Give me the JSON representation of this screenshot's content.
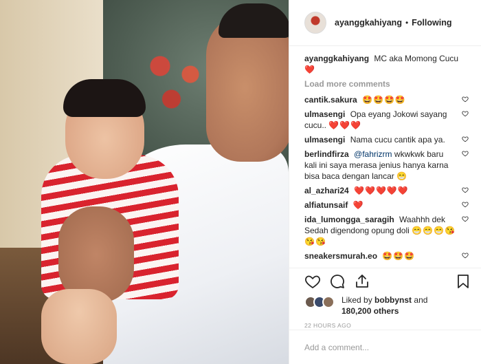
{
  "post": {
    "username": "ayanggkahiyang",
    "follow_status": "Following",
    "separator": "•",
    "caption_user": "ayanggkahiyang",
    "caption_text": "MC aka Momong Cucu",
    "caption_emoji": "❤️",
    "load_more": "Load more comments"
  },
  "comments": [
    {
      "user": "cantik.sakura",
      "text": "",
      "emoji": "🤩🤩🤩🤩"
    },
    {
      "user": "ulmasengi",
      "text": "Opa eyang Jokowi sayang cucu..",
      "emoji": "❤️❤️❤️"
    },
    {
      "user": "ulmasengi",
      "text": "Nama cucu cantik apa ya.",
      "emoji": ""
    },
    {
      "user": "berlindfirza",
      "mention": "@fahrizrm",
      "text": "wkwkwk baru kali ini saya merasa jenius hanya karna bisa baca dengan lancar",
      "emoji": "😁"
    },
    {
      "user": "al_azhari24",
      "text": "",
      "emoji": "❤️❤️❤️❤️❤️"
    },
    {
      "user": "alfiatunsaif",
      "text": "",
      "emoji": "❤️"
    },
    {
      "user": "ida_lumongga_saragih",
      "text": "Waahhh dek Sedah digendong opung doli",
      "emoji": "😁😁😁😘😘😘"
    },
    {
      "user": "sneakersmurah.eo",
      "text": "",
      "emoji": "🤩🤩🤩"
    }
  ],
  "likes": {
    "prefix": "Liked by",
    "user": "bobbynst",
    "middle": "and",
    "count": "180,200 others"
  },
  "timestamp": "22 HOURS AGO",
  "add_comment": {
    "placeholder": "Add a comment..."
  },
  "icons": {
    "like": "heart-icon",
    "comment": "comment-icon",
    "share": "share-icon",
    "save": "bookmark-icon"
  },
  "colors": {
    "heart_red": "#ed4956",
    "mention_blue": "#003569",
    "muted": "#999999"
  }
}
